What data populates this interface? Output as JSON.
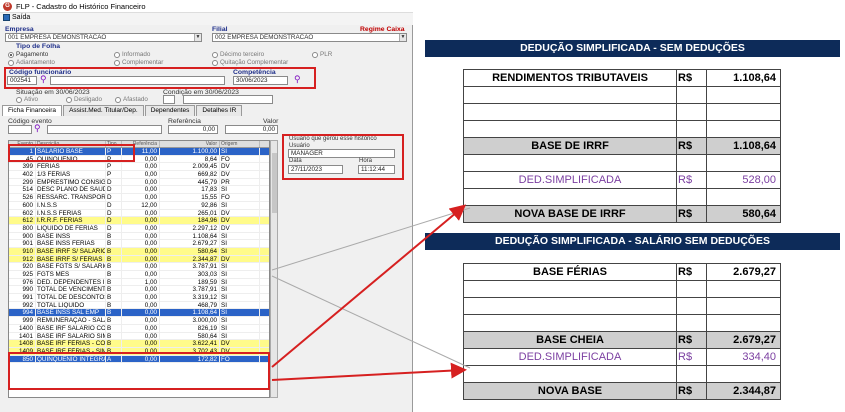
{
  "window": {
    "title": "FLP - Cadastro do Histórico Financeiro",
    "exit_label": "Saída"
  },
  "form": {
    "empresa_label": "Empresa",
    "empresa_value": "001 EMPRESA DEMONSTRACAO",
    "filial_label": "Filial",
    "filial_value": "002 EMPRESA DEMONSTRACAO",
    "regime_label": "Regime Caixa",
    "tipo_folha_label": "Tipo de Folha",
    "radios": [
      "Pagamento",
      "Informado",
      "Décimo terceiro",
      "PLR",
      "Adiantamento",
      "Complementar",
      "Quitação Complementar"
    ],
    "codigo_label": "Código funcionário",
    "codigo_value": "002541",
    "competencia_label": "Competência",
    "competencia_value": "30/06/2023",
    "situacao_label": "Situação em  30/06/2023",
    "condicao_label": "Condição em 30/06/2023",
    "situacao_options": [
      "Ativo",
      "Desligado",
      "Afastado"
    ]
  },
  "tabs": [
    "Ficha Financeira",
    "Assist.Med. Titular/Dep.",
    "Dependentes",
    "Detalhes IR"
  ],
  "filters": {
    "codigo_evento_label": "Código evento",
    "referencia_label": "Referência",
    "valor_label": "Valor",
    "referencia_value": "0,00",
    "valor_value": "0,00"
  },
  "grid": {
    "headers": [
      "Evento",
      "Descrição",
      "Tipo",
      "Referência",
      "Valor",
      "Origem"
    ],
    "rows": [
      {
        "ev": "1",
        "desc": "SALARIO BASE",
        "tipo": "P",
        "ref": "11,00",
        "val": "1.100,00",
        "orig": "SI",
        "style": "blue"
      },
      {
        "ev": "45",
        "desc": "QUINQUENIO",
        "tipo": "P",
        "ref": "0,00",
        "val": "8,64",
        "orig": "FO",
        "style": "white"
      },
      {
        "ev": "399",
        "desc": "FERIAS",
        "tipo": "P",
        "ref": "0,00",
        "val": "2.009,45",
        "orig": "DV",
        "style": "white"
      },
      {
        "ev": "402",
        "desc": "1/3 FERIAS",
        "tipo": "P",
        "ref": "0,00",
        "val": "669,82",
        "orig": "DV",
        "style": "white"
      },
      {
        "ev": "299",
        "desc": "EMPRESTIMO CONSIGN...",
        "tipo": "D",
        "ref": "0,00",
        "val": "445,79",
        "orig": "PR",
        "style": "white"
      },
      {
        "ev": "514",
        "desc": "DESC PLANO DE SAUDE",
        "tipo": "D",
        "ref": "0,00",
        "val": "17,83",
        "orig": "SI",
        "style": "white"
      },
      {
        "ev": "526",
        "desc": "RESSARC. TRANSPORTE",
        "tipo": "D",
        "ref": "0,00",
        "val": "15,55",
        "orig": "FO",
        "style": "white"
      },
      {
        "ev": "600",
        "desc": "I.N.S.S",
        "tipo": "D",
        "ref": "12,00",
        "val": "92,86",
        "orig": "SI",
        "style": "white"
      },
      {
        "ev": "602",
        "desc": "I.N.S.S FERIAS",
        "tipo": "D",
        "ref": "0,00",
        "val": "265,01",
        "orig": "DV",
        "style": "white"
      },
      {
        "ev": "612",
        "desc": "I.R.R.F. FERIAS",
        "tipo": "D",
        "ref": "0,00",
        "val": "184,96",
        "orig": "DV",
        "style": "yellow"
      },
      {
        "ev": "800",
        "desc": "LIQUIDO DE FERIAS",
        "tipo": "D",
        "ref": "0,00",
        "val": "2.297,12",
        "orig": "DV",
        "style": "white"
      },
      {
        "ev": "900",
        "desc": "BASE INSS",
        "tipo": "B",
        "ref": "0,00",
        "val": "1.108,64",
        "orig": "SI",
        "style": "white"
      },
      {
        "ev": "901",
        "desc": "BASE INSS FERIAS",
        "tipo": "B",
        "ref": "0,00",
        "val": "2.679,27",
        "orig": "SI",
        "style": "white"
      },
      {
        "ev": "910",
        "desc": "BASE IRRF S/ SALÁRIOS",
        "tipo": "B",
        "ref": "0,00",
        "val": "580,64",
        "orig": "SI",
        "style": "yellow"
      },
      {
        "ev": "912",
        "desc": "BASE IRRF S/ FÉRIAS",
        "tipo": "B",
        "ref": "0,00",
        "val": "2.344,87",
        "orig": "DV",
        "style": "yellow"
      },
      {
        "ev": "920",
        "desc": "BASE FGTS S/ SALARIO",
        "tipo": "B",
        "ref": "0,00",
        "val": "3.787,91",
        "orig": "SI",
        "style": "white"
      },
      {
        "ev": "925",
        "desc": "FGTS MES",
        "tipo": "B",
        "ref": "0,00",
        "val": "303,03",
        "orig": "SI",
        "style": "white"
      },
      {
        "ev": "976",
        "desc": "DED. DEPENDENTES IRF",
        "tipo": "B",
        "ref": "1,00",
        "val": "189,59",
        "orig": "SI",
        "style": "white"
      },
      {
        "ev": "990",
        "desc": "TOTAL DE VENCIMENTOS",
        "tipo": "B",
        "ref": "0,00",
        "val": "3.787,91",
        "orig": "SI",
        "style": "white"
      },
      {
        "ev": "991",
        "desc": "TOTAL DE DESCONTOS",
        "tipo": "B",
        "ref": "0,00",
        "val": "3.319,12",
        "orig": "SI",
        "style": "white"
      },
      {
        "ev": "992",
        "desc": "TOTAL LIQUIDO",
        "tipo": "B",
        "ref": "0,00",
        "val": "468,79",
        "orig": "SI",
        "style": "white"
      },
      {
        "ev": "994",
        "desc": "BASE INSS SAL EMP",
        "tipo": "B",
        "ref": "0,00",
        "val": "1.108,64",
        "orig": "SI",
        "style": "blue"
      },
      {
        "ev": "999",
        "desc": "REMUNERAÇÃO - SALÁ",
        "tipo": "B",
        "ref": "0,00",
        "val": "3.000,00",
        "orig": "SI",
        "style": "white"
      },
      {
        "ev": "1400",
        "desc": "BASE IRF SALARIO CONV",
        "tipo": "B",
        "ref": "0,00",
        "val": "826,19",
        "orig": "SI",
        "style": "white"
      },
      {
        "ev": "1401",
        "desc": "BASE IRF SALARIO SIMP",
        "tipo": "B",
        "ref": "0,00",
        "val": "580,64",
        "orig": "SI",
        "style": "white"
      },
      {
        "ev": "1408",
        "desc": "BASE IRF FÉRIAS - CONV",
        "tipo": "B",
        "ref": "0,00",
        "val": "3.622,41",
        "orig": "DV",
        "style": "yellow"
      },
      {
        "ev": "1409",
        "desc": "BASE IRF FÉRIAS - SIMP",
        "tipo": "B",
        "ref": "0,00",
        "val": "3.702,43",
        "orig": "DV",
        "style": "yellow"
      },
      {
        "ev": "850",
        "desc": "QUINQUENIO INTEGRAL",
        "tipo": "A",
        "ref": "0,00",
        "val": "172,82",
        "orig": "FO",
        "style": "blue"
      }
    ]
  },
  "historico": {
    "title": "Usuário que gerou esse histórico",
    "usuario_label": "Usuário",
    "usuario_value": "MANAGER",
    "data_label": "Data",
    "data_value": "27/11/2023",
    "hora_label": "Hora",
    "hora_value": "11:12:44"
  },
  "panel1": {
    "banner": "DEDUÇÃO SIMPLIFICADA - SEM DEDUÇÕES",
    "rows": [
      {
        "label": "RENDIMENTOS TRIBUTAVEIS",
        "cur": "R$",
        "val": "1.108,64",
        "style": "bold"
      },
      {
        "label": "",
        "cur": "",
        "val": "",
        "style": "blank"
      },
      {
        "label": "",
        "cur": "",
        "val": "",
        "style": "blank"
      },
      {
        "label": "",
        "cur": "",
        "val": "",
        "style": "blank"
      },
      {
        "label": "BASE DE IRRF",
        "cur": "R$",
        "val": "1.108,64",
        "style": "gray"
      },
      {
        "label": "",
        "cur": "",
        "val": "",
        "style": "blank"
      },
      {
        "label": "DED.SIMPLIFICADA",
        "cur": "R$",
        "val": "528,00",
        "style": "purple"
      },
      {
        "label": "",
        "cur": "",
        "val": "",
        "style": "blank"
      },
      {
        "label": "NOVA BASE DE IRRF",
        "cur": "R$",
        "val": "580,64",
        "style": "gray"
      }
    ]
  },
  "panel2": {
    "banner": "DEDUÇÃO SIMPLIFICADA - SALÁRIO SEM DEDUÇÕES",
    "rows": [
      {
        "label": "BASE FÉRIAS",
        "cur": "R$",
        "val": "2.679,27",
        "style": "bold"
      },
      {
        "label": "",
        "cur": "",
        "val": "",
        "style": "blank"
      },
      {
        "label": "",
        "cur": "",
        "val": "",
        "style": "blank"
      },
      {
        "label": "",
        "cur": "",
        "val": "",
        "style": "blank"
      },
      {
        "label": "BASE CHEIA",
        "cur": "R$",
        "val": "2.679,27",
        "style": "gray"
      },
      {
        "label": "DED.SIMPLIFICADA",
        "cur": "R$",
        "val": "334,40",
        "style": "purple"
      },
      {
        "label": "",
        "cur": "",
        "val": "",
        "style": "blank"
      },
      {
        "label": "NOVA BASE",
        "cur": "R$",
        "val": "2.344,87",
        "style": "gray"
      }
    ]
  },
  "colors": {
    "accent": "#2b63c7",
    "highlight": "#fffb8a",
    "banner": "#0d2b59",
    "annotation": "#d62020",
    "purple": "#7b3fa1"
  }
}
